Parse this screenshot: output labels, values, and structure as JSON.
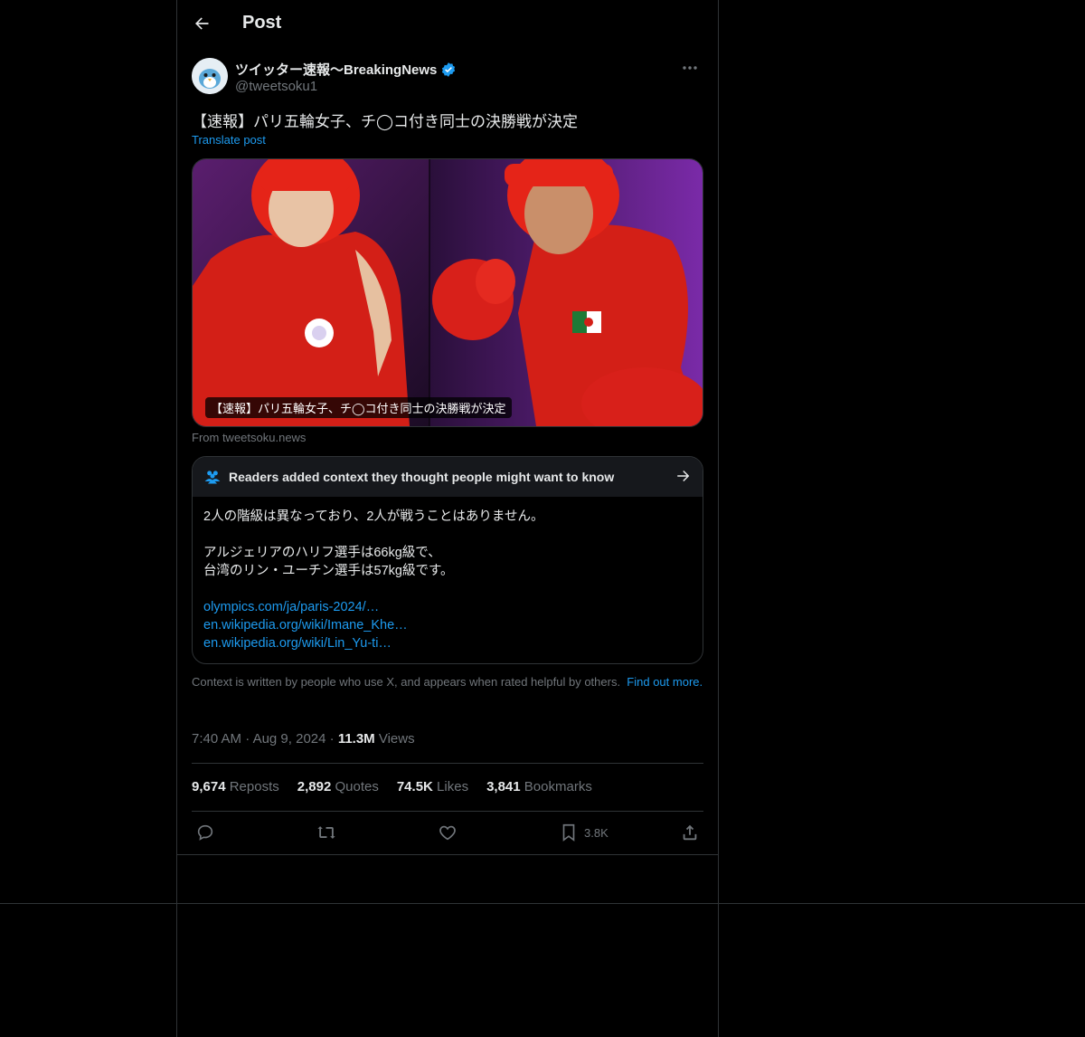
{
  "header": {
    "title": "Post"
  },
  "author": {
    "name": "ツイッター速報〜BreakingNews",
    "handle": "@tweetsoku1",
    "verified": true
  },
  "post": {
    "text": "【速報】パリ五輪女子、チ◯コ付き同士の決勝戦が決定",
    "translate_label": "Translate post"
  },
  "card": {
    "caption": "【速報】パリ五輪女子、チ◯コ付き同士の決勝戦が決定",
    "from": "From tweetsoku.news"
  },
  "note": {
    "header": "Readers added context they thought people might want to know",
    "line1": "2人の階級は異なっており、2人が戦うことはありません。",
    "line2": "アルジェリアのハリフ選手は66kg級で、",
    "line3": "台湾のリン・ユーチン選手は57kg級です。",
    "links": [
      "olympics.com/ja/paris-2024/…",
      "en.wikipedia.org/wiki/Imane_Khe…",
      "en.wikipedia.org/wiki/Lin_Yu-ti…"
    ]
  },
  "context": {
    "text": "Context is written by people who use X, and appears when rated helpful by others.",
    "find_out": "Find out more."
  },
  "meta": {
    "time": "7:40 AM",
    "date": "Aug 9, 2024",
    "views_count": "11.3M",
    "views_label": "Views"
  },
  "stats": {
    "reposts_count": "9,674",
    "reposts_label": "Reposts",
    "quotes_count": "2,892",
    "quotes_label": "Quotes",
    "likes_count": "74.5K",
    "likes_label": "Likes",
    "bookmarks_count": "3,841",
    "bookmarks_label": "Bookmarks"
  },
  "actions": {
    "bookmark_count": "3.8K",
    "icons": [
      "reply-icon",
      "repost-icon",
      "like-icon",
      "bookmark-icon",
      "share-icon"
    ]
  },
  "colors": {
    "background": "#000000",
    "text": "#e7e9ea",
    "muted": "#71767b",
    "accent": "#1d9bf0",
    "border": "#2f3336"
  }
}
